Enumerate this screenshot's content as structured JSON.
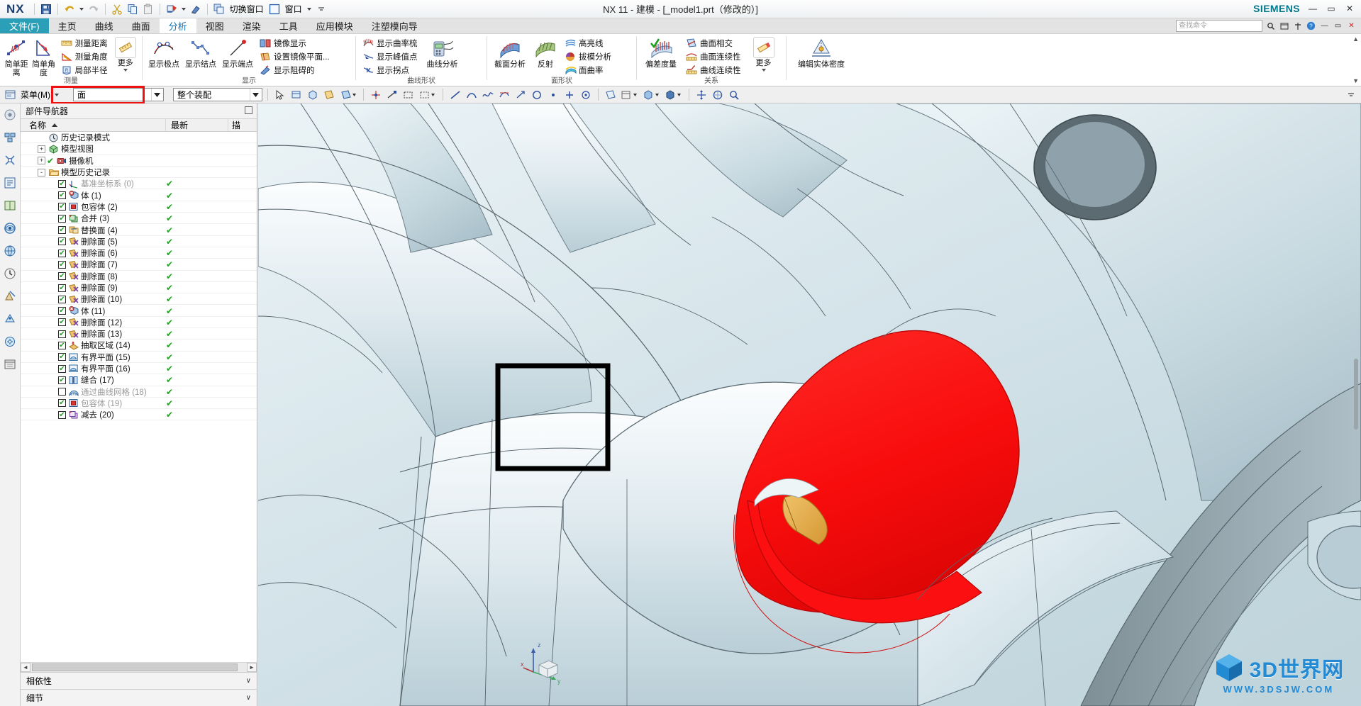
{
  "titlebar": {
    "logo": "NX",
    "title": "NX 11 - 建模 - [_model1.prt（修改的）]",
    "brand": "SIEMENS",
    "quick_access": [
      {
        "name": "save",
        "label": "保存"
      },
      {
        "name": "undo",
        "label": "撤销"
      },
      {
        "name": "redo",
        "label": "重做"
      },
      {
        "name": "cut",
        "label": "剪切"
      },
      {
        "name": "copy",
        "label": "复制"
      },
      {
        "name": "paste",
        "label": "粘贴"
      },
      {
        "name": "redisplay",
        "label": "重新显示"
      },
      {
        "name": "erase",
        "label": "擦除"
      }
    ],
    "switch_window": "切换窗口",
    "window": "窗口",
    "win_min": "—",
    "win_max": "▭",
    "win_close": "✕"
  },
  "tabs": [
    {
      "label": "文件(F)",
      "state": "file"
    },
    {
      "label": "主页",
      "state": "normal"
    },
    {
      "label": "曲线",
      "state": "normal"
    },
    {
      "label": "曲面",
      "state": "normal"
    },
    {
      "label": "分析",
      "state": "active"
    },
    {
      "label": "视图",
      "state": "normal"
    },
    {
      "label": "渲染",
      "state": "normal"
    },
    {
      "label": "工具",
      "state": "normal"
    },
    {
      "label": "应用模块",
      "state": "normal"
    },
    {
      "label": "注塑模向导",
      "state": "normal"
    }
  ],
  "tab_search": {
    "placeholder": "查找命令"
  },
  "ribbon": {
    "groups": [
      {
        "label": "测量",
        "big": [
          {
            "label": "简单距离",
            "icon": "simple-distance-icon"
          },
          {
            "label": "简单角度",
            "icon": "simple-angle-icon"
          }
        ],
        "small": [
          {
            "label": "测量距离",
            "icon": "measure-distance-icon"
          },
          {
            "label": "测量角度",
            "icon": "measure-angle-icon"
          },
          {
            "label": "局部半径",
            "icon": "local-radius-icon"
          }
        ],
        "more": {
          "label": "更多",
          "icon": "more-measure-icon"
        }
      },
      {
        "label": "显示",
        "big": [
          {
            "label": "显示极点",
            "icon": "show-poles-icon"
          },
          {
            "label": "显示结点",
            "icon": "show-knots-icon"
          },
          {
            "label": "显示端点",
            "icon": "show-endpoints-icon"
          }
        ],
        "small": [
          {
            "label": "镜像显示",
            "icon": "mirror-display-icon"
          },
          {
            "label": "设置镜像平面...",
            "icon": "set-mirror-plane-icon"
          },
          {
            "label": "显示阻碍的",
            "icon": "show-obstructed-icon"
          }
        ],
        "more": null
      },
      {
        "label": "曲线形状",
        "big": [
          {
            "label": "曲线分析",
            "icon": "curve-analysis-icon"
          }
        ],
        "small": [
          {
            "label": "显示曲率梳",
            "icon": "show-curvature-comb-icon"
          },
          {
            "label": "显示峰值点",
            "icon": "show-peak-points-icon"
          },
          {
            "label": "显示拐点",
            "icon": "show-inflection-points-icon"
          }
        ],
        "more": null
      },
      {
        "label": "面形状",
        "big": [
          {
            "label": "截面分析",
            "icon": "section-analysis-icon"
          },
          {
            "label": "反射",
            "icon": "reflection-icon"
          }
        ],
        "small": [
          {
            "label": "高亮线",
            "icon": "highlight-lines-icon"
          },
          {
            "label": "拔模分析",
            "icon": "draft-analysis-icon"
          },
          {
            "label": "面曲率",
            "icon": "face-curvature-icon"
          }
        ],
        "more": null
      },
      {
        "label": "关系",
        "big": [
          {
            "label": "偏差度量",
            "icon": "deviation-gauge-icon"
          }
        ],
        "small": [
          {
            "label": "曲面相交",
            "icon": "surface-intersection-icon"
          },
          {
            "label": "曲面连续性",
            "icon": "surface-continuity-icon"
          },
          {
            "label": "曲线连续性",
            "icon": "curve-continuity-icon"
          }
        ],
        "more": {
          "label": "更多",
          "icon": "more-relations-icon"
        }
      },
      {
        "label": "",
        "big": [
          {
            "label": "编辑实体密度",
            "icon": "edit-solid-density-icon"
          }
        ],
        "small": [],
        "more": null
      }
    ]
  },
  "seltoolbar": {
    "menu_label": "菜单(M)",
    "type_filter": {
      "value": "面",
      "name": "type-filter-combo"
    },
    "scope_filter": {
      "value": "整个装配",
      "name": "scope-filter-combo"
    },
    "icons": [
      "select-general-icon",
      "select-face-icon",
      "select-edge-icon",
      "select-feature-icon",
      "snap-point-icon",
      "snap-endpoint-icon",
      "rectangle-select-icon",
      "lasso-select-icon",
      "curve-rule-icon",
      "tangent-curve-icon",
      "face-rule-icon",
      "body-rule-icon",
      "point-icon",
      "circle-icon",
      "plus-icon",
      "arc-icon",
      "line-icon",
      "plane-icon",
      "datum-icon",
      "layer-icon",
      "visibility-icon",
      "wireframe-icon",
      "shaded-icon",
      "orient-view-icon",
      "fit-view-icon",
      "zoom-icon"
    ]
  },
  "rail": {
    "items": [
      {
        "name": "home-rail-icon"
      },
      {
        "name": "part-navigator-rail-icon"
      },
      {
        "name": "assembly-navigator-rail-icon"
      },
      {
        "name": "constraint-navigator-rail-icon"
      },
      {
        "name": "reuse-library-rail-icon"
      },
      {
        "name": "hd3d-rail-icon"
      },
      {
        "name": "web-browser-rail-icon"
      },
      {
        "name": "history-rail-icon"
      },
      {
        "name": "process-studio-rail-icon"
      },
      {
        "name": "roles-rail-icon"
      },
      {
        "name": "system-materials-rail-icon"
      },
      {
        "name": "layers-rail-icon"
      }
    ]
  },
  "part_navigator": {
    "title": "部件导航器",
    "columns": [
      "名称",
      "最新",
      "描"
    ],
    "rows": [
      {
        "indent": 1,
        "twist": "",
        "check": "none",
        "icon": "clock-icon",
        "label": "历史记录模式",
        "dim": false,
        "updated": false
      },
      {
        "indent": 1,
        "twist": "+",
        "check": "none",
        "icon": "model-views-icon",
        "label": "模型视图",
        "dim": false,
        "updated": false
      },
      {
        "indent": 1,
        "twist": "+",
        "check": "green",
        "icon": "camera-icon",
        "label": "摄像机",
        "dim": false,
        "updated": false
      },
      {
        "indent": 1,
        "twist": "-",
        "check": "none",
        "icon": "folder-icon",
        "label": "模型历史记录",
        "dim": false,
        "updated": false
      },
      {
        "indent": 2,
        "twist": "",
        "check": "checked",
        "icon": "datum-csys-icon",
        "label": "基准坐标系 (0)",
        "dim": true,
        "updated": true
      },
      {
        "indent": 2,
        "twist": "",
        "check": "checked",
        "icon": "body-icon",
        "label": "体 (1)",
        "dim": false,
        "updated": true
      },
      {
        "indent": 2,
        "twist": "",
        "check": "checked",
        "icon": "bounded-body-icon",
        "label": "包容体 (2)",
        "dim": false,
        "updated": true
      },
      {
        "indent": 2,
        "twist": "",
        "check": "checked",
        "icon": "unite-icon",
        "label": "合并 (3)",
        "dim": false,
        "updated": true
      },
      {
        "indent": 2,
        "twist": "",
        "check": "info",
        "icon": "replace-face-icon",
        "label": "替换面 (4)",
        "dim": false,
        "updated": true
      },
      {
        "indent": 2,
        "twist": "",
        "check": "checked",
        "icon": "delete-face-icon",
        "label": "删除面 (5)",
        "dim": false,
        "updated": true
      },
      {
        "indent": 2,
        "twist": "",
        "check": "checked",
        "icon": "delete-face-icon",
        "label": "删除面 (6)",
        "dim": false,
        "updated": true
      },
      {
        "indent": 2,
        "twist": "",
        "check": "checked",
        "icon": "delete-face-icon",
        "label": "删除面 (7)",
        "dim": false,
        "updated": true
      },
      {
        "indent": 2,
        "twist": "",
        "check": "checked",
        "icon": "delete-face-icon",
        "label": "删除面 (8)",
        "dim": false,
        "updated": true
      },
      {
        "indent": 2,
        "twist": "",
        "check": "checked",
        "icon": "delete-face-icon",
        "label": "删除面 (9)",
        "dim": false,
        "updated": true
      },
      {
        "indent": 2,
        "twist": "",
        "check": "checked",
        "icon": "delete-face-icon",
        "label": "删除面 (10)",
        "dim": false,
        "updated": true
      },
      {
        "indent": 2,
        "twist": "",
        "check": "checked",
        "icon": "body-icon",
        "label": "体 (11)",
        "dim": false,
        "updated": true
      },
      {
        "indent": 2,
        "twist": "",
        "check": "checked",
        "icon": "delete-face-icon",
        "label": "删除面 (12)",
        "dim": false,
        "updated": true
      },
      {
        "indent": 2,
        "twist": "",
        "check": "checked",
        "icon": "delete-face-icon",
        "label": "删除面 (13)",
        "dim": false,
        "updated": true
      },
      {
        "indent": 2,
        "twist": "",
        "check": "checked",
        "icon": "extract-region-icon",
        "label": "抽取区域 (14)",
        "dim": false,
        "updated": true
      },
      {
        "indent": 2,
        "twist": "",
        "check": "checked",
        "icon": "bounded-plane-icon",
        "label": "有界平面 (15)",
        "dim": false,
        "updated": true
      },
      {
        "indent": 2,
        "twist": "",
        "check": "checked",
        "icon": "bounded-plane-icon",
        "label": "有界平面 (16)",
        "dim": false,
        "updated": true
      },
      {
        "indent": 2,
        "twist": "",
        "check": "checked",
        "icon": "sew-icon",
        "label": "缝合 (17)",
        "dim": false,
        "updated": true
      },
      {
        "indent": 2,
        "twist": "",
        "check": "unchecked",
        "icon": "through-curve-mesh-icon",
        "label": "通过曲线网格 (18)",
        "dim": true,
        "updated": true
      },
      {
        "indent": 2,
        "twist": "",
        "check": "checked",
        "icon": "bounded-body-icon",
        "label": "包容体 (19)",
        "dim": true,
        "updated": true
      },
      {
        "indent": 2,
        "twist": "",
        "check": "checked",
        "icon": "subtract-icon",
        "label": "减去 (20)",
        "dim": false,
        "updated": true
      }
    ],
    "sections": [
      {
        "label": "相依性",
        "name": "dependencies-section"
      },
      {
        "label": "细节",
        "name": "details-section"
      }
    ]
  },
  "viewport": {
    "selected_face_color": "#fb0f11",
    "highlight_face_color": "#e0a543",
    "marquee_color": "#000000",
    "background_color": "#cfe0e6",
    "triad_labels": {
      "x": "x",
      "y": "y",
      "z": "z"
    }
  },
  "watermark": {
    "text": "3D世界网",
    "url": "WWW.3DSJW.COM"
  }
}
